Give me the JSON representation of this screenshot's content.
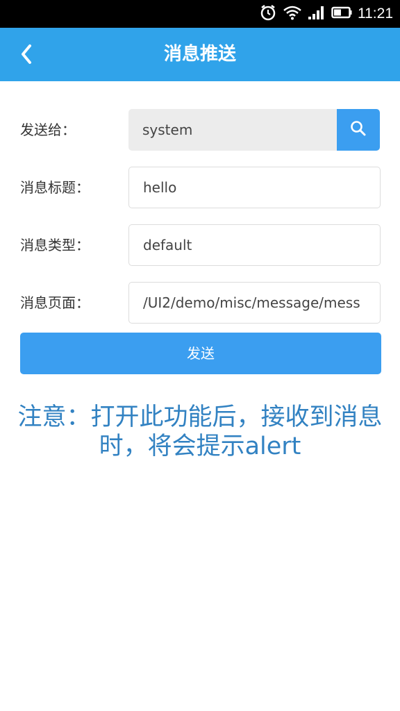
{
  "status_bar": {
    "time": "11:21",
    "icons": [
      "alarm-icon",
      "wifi-icon",
      "signal-icon",
      "battery-icon"
    ]
  },
  "header": {
    "title": "消息推送",
    "back_icon": "chevron-left-icon",
    "background": "#30a3ea"
  },
  "form": {
    "send_to": {
      "label": "发送给：",
      "value": "system"
    },
    "title": {
      "label": "消息标题：",
      "value": "hello"
    },
    "type": {
      "label": "消息类型：",
      "value": "default"
    },
    "page": {
      "label": "消息页面：",
      "value": "/UI2/demo/misc/message/mess"
    }
  },
  "send_button_label": "发送",
  "notice": "注意：打开此功能后，接收到消息时，将会提示alert",
  "colors": {
    "accent": "#3b9ef0",
    "notice": "#3282c2"
  }
}
